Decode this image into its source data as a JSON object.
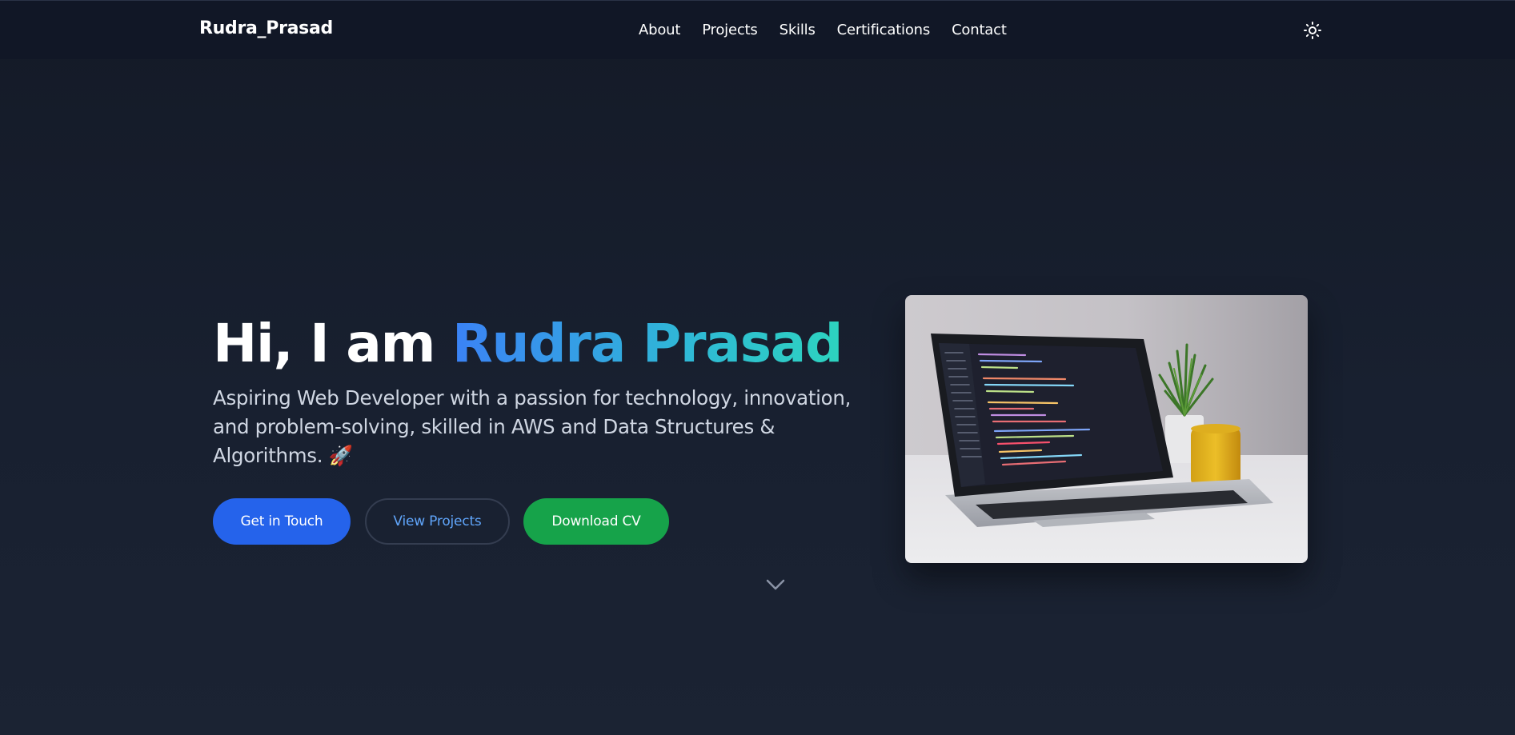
{
  "navbar": {
    "brand": "Rudra_Prasad",
    "links": [
      "About",
      "Projects",
      "Skills",
      "Certifications",
      "Contact"
    ],
    "theme_toggle_icon": "sun-icon"
  },
  "hero": {
    "greeting": "Hi, I am ",
    "name": "Rudra Prasad",
    "subtitle": "Aspiring Web Developer with a passion for technology, innovation, and problem-solving, skilled in AWS and Data Structures & Algorithms. 🚀",
    "buttons": {
      "get_in_touch": "Get in Touch",
      "view_projects": "View Projects",
      "download_cv": "Download CV"
    },
    "scroll_icon": "chevron-down-icon",
    "image_subject": "laptop-with-code-editor-on-desk"
  },
  "colors": {
    "background": "#161d2b",
    "navbar": "#111726",
    "primary_button": "#2563eb",
    "success_button": "#16a34a",
    "link_blue": "#60a5fa",
    "gradient_start": "#3b82f6",
    "gradient_end": "#2dd4bf"
  }
}
